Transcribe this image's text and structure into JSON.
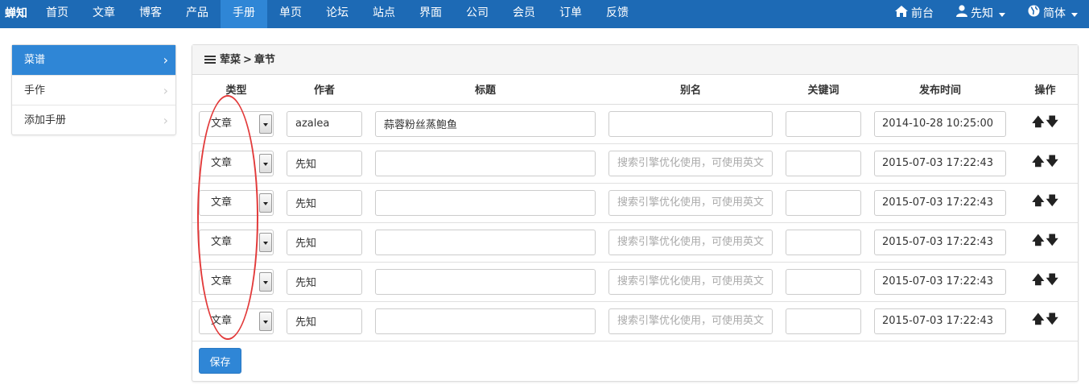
{
  "brand": "蝉知",
  "nav": {
    "items": [
      "首页",
      "文章",
      "博客",
      "产品",
      "手册",
      "单页",
      "论坛",
      "站点",
      "界面",
      "公司",
      "会员",
      "订单",
      "反馈"
    ],
    "active_index": 4
  },
  "nav_right": {
    "frontend": "前台",
    "user": "先知",
    "language": "简体"
  },
  "sidebar": {
    "items": [
      {
        "label": "菜谱",
        "active": true
      },
      {
        "label": "手作",
        "active": false
      },
      {
        "label": "添加手册",
        "active": false
      }
    ]
  },
  "panel": {
    "breadcrumb_parent": "荤菜",
    "breadcrumb_sep": ">",
    "breadcrumb_current": "章节"
  },
  "table": {
    "headers": [
      "类型",
      "作者",
      "标题",
      "别名",
      "关键词",
      "发布时间",
      "操作"
    ],
    "alias_placeholder": "搜索引擎优化使用，可使用英文",
    "rows": [
      {
        "type": "文章",
        "author": "azalea",
        "title": "蒜蓉粉丝蒸鲍鱼",
        "alias": "",
        "keywords": "",
        "date": "2014-10-28 10:25:00"
      },
      {
        "type": "文章",
        "author": "先知",
        "title": "",
        "alias": "",
        "keywords": "",
        "date": "2015-07-03 17:22:43"
      },
      {
        "type": "文章",
        "author": "先知",
        "title": "",
        "alias": "",
        "keywords": "",
        "date": "2015-07-03 17:22:43"
      },
      {
        "type": "文章",
        "author": "先知",
        "title": "",
        "alias": "",
        "keywords": "",
        "date": "2015-07-03 17:22:43"
      },
      {
        "type": "文章",
        "author": "先知",
        "title": "",
        "alias": "",
        "keywords": "",
        "date": "2015-07-03 17:22:43"
      },
      {
        "type": "文章",
        "author": "先知",
        "title": "",
        "alias": "",
        "keywords": "",
        "date": "2015-07-03 17:22:43"
      }
    ]
  },
  "ops": {
    "up": "🡅",
    "down": "🡇"
  },
  "save_label": "保存",
  "colors": {
    "nav_bg": "#1d6ab5",
    "accent": "#2f86d6",
    "annotation": "#e23a3a"
  }
}
